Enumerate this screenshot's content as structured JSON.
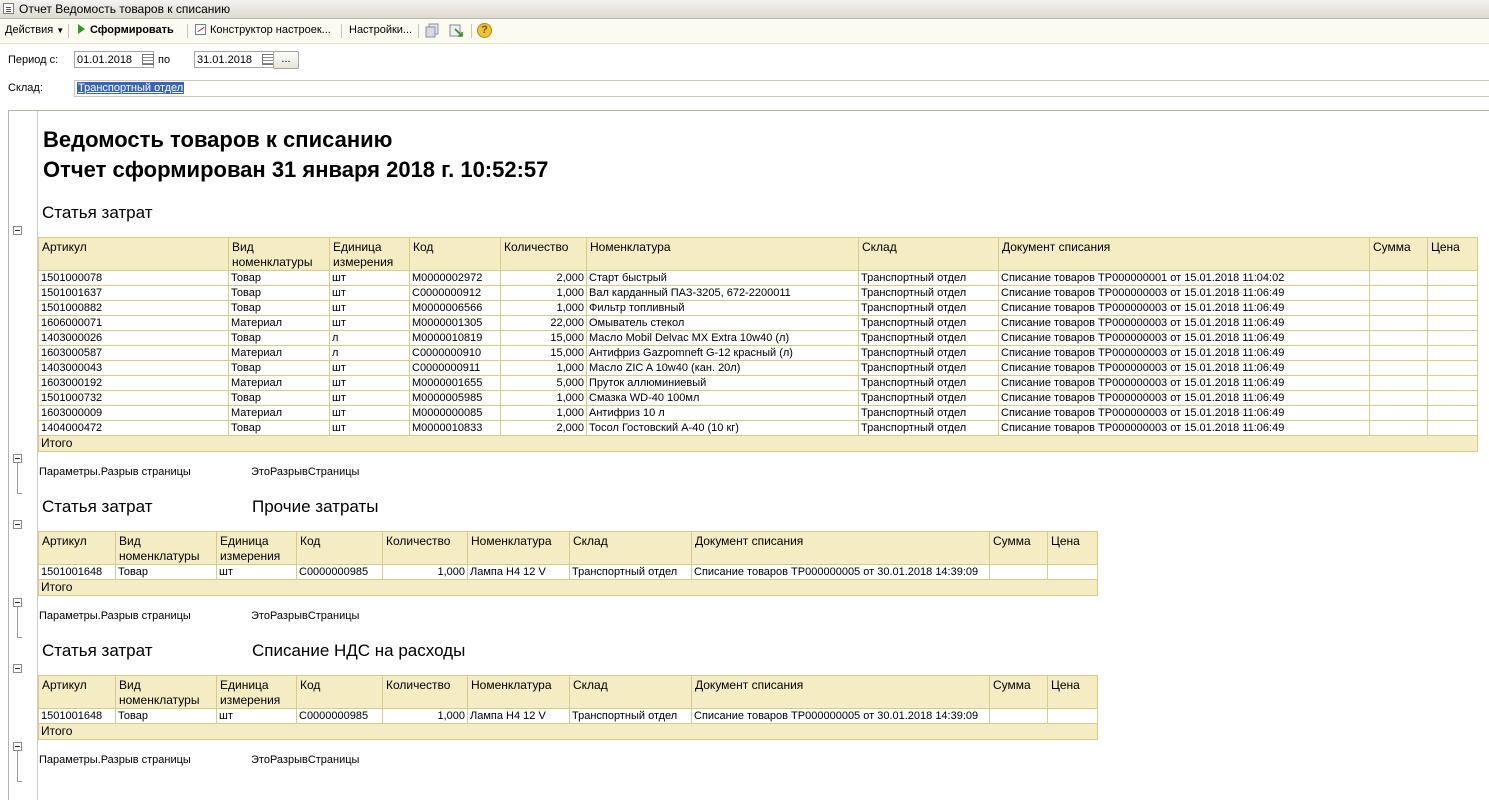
{
  "window": {
    "title": "Отчет  Ведомость товаров к списанию"
  },
  "toolbar": {
    "actions_label": "Действия",
    "generate_label": "Сформировать",
    "constructor_label": "Конструктор настроек...",
    "settings_label": "Настройки..."
  },
  "params": {
    "period_from_label": "Период с:",
    "period_from": "01.01.2018",
    "period_to_label": "по",
    "period_to": "31.01.2018",
    "ellipsis": "...",
    "warehouse_label": "Склад:",
    "warehouse_value": "Транспортный отдел"
  },
  "report": {
    "title": "Ведомость товаров к списанию",
    "generated": "Отчет сформирован 31 января 2018 г. 10:52:57",
    "page_break_label": "Параметры.Разрыв страницы",
    "page_break_value": "ЭтоРазрывСтраницы",
    "total_label": "Итого",
    "columns": {
      "article": "Артикул",
      "kind": "Вид номенклатуры",
      "unit": "Единица измерения",
      "code": "Код",
      "qty": "Количество",
      "nomenclature": "Номенклатура",
      "warehouse": "Склад",
      "document": "Документ списания",
      "sum": "Сумма",
      "price": "Цена"
    },
    "sections": [
      {
        "label": "Статья затрат",
        "value": "",
        "rows": [
          {
            "article": "1501000078",
            "kind": "Товар",
            "unit": "шт",
            "code": "М0000002972",
            "qty": "2,000",
            "nomenclature": "Старт быстрый",
            "warehouse": "Транспортный отдел",
            "document": "Списание товаров ТР000000001 от 15.01.2018 11:04:02"
          },
          {
            "article": "1501001637",
            "kind": "Товар",
            "unit": "шт",
            "code": "С0000000912",
            "qty": "1,000",
            "nomenclature": "Вал карданный ПАЗ-3205, 672-2200011",
            "warehouse": "Транспортный отдел",
            "document": "Списание товаров ТР000000003 от 15.01.2018 11:06:49"
          },
          {
            "article": "1501000882",
            "kind": "Товар",
            "unit": "шт",
            "code": "М0000006566",
            "qty": "1,000",
            "nomenclature": "Фильтр топливный",
            "warehouse": "Транспортный отдел",
            "document": "Списание товаров ТР000000003 от 15.01.2018 11:06:49"
          },
          {
            "article": "1606000071",
            "kind": "Материал",
            "unit": "шт",
            "code": "М0000001305",
            "qty": "22,000",
            "nomenclature": "Омыватель стекол",
            "warehouse": "Транспортный отдел",
            "document": "Списание товаров ТР000000003 от 15.01.2018 11:06:49"
          },
          {
            "article": "1403000026",
            "kind": "Товар",
            "unit": "л",
            "code": "М0000010819",
            "qty": "15,000",
            "nomenclature": "Масло Mobil Delvac MX Extra 10w40 (л)",
            "warehouse": "Транспортный отдел",
            "document": "Списание товаров ТР000000003 от 15.01.2018 11:06:49"
          },
          {
            "article": "1603000587",
            "kind": "Материал",
            "unit": "л",
            "code": "С0000000910",
            "qty": "15,000",
            "nomenclature": "Антифриз Gazpomneft G-12 красный (л)",
            "warehouse": "Транспортный отдел",
            "document": "Списание товаров ТР000000003 от 15.01.2018 11:06:49"
          },
          {
            "article": "1403000043",
            "kind": "Товар",
            "unit": "шт",
            "code": "С0000000911",
            "qty": "1,000",
            "nomenclature": "Масло ZIC A 10w40 (кан. 20л)",
            "warehouse": "Транспортный отдел",
            "document": "Списание товаров ТР000000003 от 15.01.2018 11:06:49"
          },
          {
            "article": "1603000192",
            "kind": "Материал",
            "unit": "шт",
            "code": "М0000001655",
            "qty": "5,000",
            "nomenclature": "Пруток аллюминиевый",
            "warehouse": "Транспортный отдел",
            "document": "Списание товаров ТР000000003 от 15.01.2018 11:06:49"
          },
          {
            "article": "1501000732",
            "kind": "Товар",
            "unit": "шт",
            "code": "М0000005985",
            "qty": "1,000",
            "nomenclature": "Смазка WD-40 100мл",
            "warehouse": "Транспортный отдел",
            "document": "Списание товаров ТР000000003 от 15.01.2018 11:06:49"
          },
          {
            "article": "1603000009",
            "kind": "Материал",
            "unit": "шт",
            "code": "М0000000085",
            "qty": "1,000",
            "nomenclature": "Антифриз 10 л",
            "warehouse": "Транспортный отдел",
            "document": "Списание товаров ТР000000003 от 15.01.2018 11:06:49"
          },
          {
            "article": "1404000472",
            "kind": "Товар",
            "unit": "шт",
            "code": "М0000010833",
            "qty": "2,000",
            "nomenclature": "Тосол Гостовский А-40 (10 кг)",
            "warehouse": "Транспортный отдел",
            "document": "Списание товаров ТР000000003 от 15.01.2018 11:06:49"
          }
        ]
      },
      {
        "label": "Статья затрат",
        "value": "Прочие затраты",
        "rows": [
          {
            "article": "1501001648",
            "kind": "Товар",
            "unit": "шт",
            "code": "С0000000985",
            "qty": "1,000",
            "nomenclature": "Лампа Н4 12 V",
            "warehouse": "Транспортный отдел",
            "document": "Списание товаров ТР000000005 от 30.01.2018 14:39:09"
          }
        ]
      },
      {
        "label": "Статья затрат",
        "value": "Списание НДС на расходы",
        "rows": [
          {
            "article": "1501001648",
            "kind": "Товар",
            "unit": "шт",
            "code": "С0000000985",
            "qty": "1,000",
            "nomenclature": "Лампа Н4 12 V",
            "warehouse": "Транспортный отдел",
            "document": "Списание товаров ТР000000005 от 30.01.2018 14:39:09"
          }
        ]
      }
    ]
  }
}
